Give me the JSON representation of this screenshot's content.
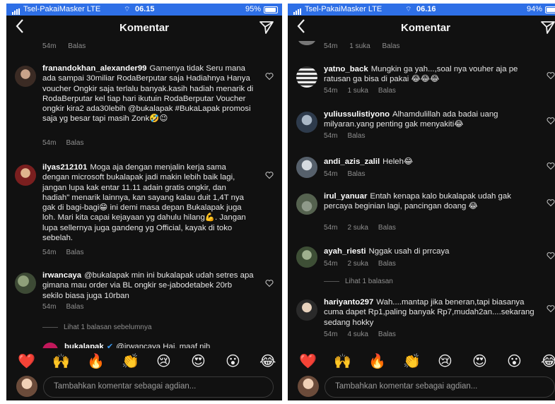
{
  "left": {
    "status": {
      "carrier": "Tsel-PakaiMasker LTE",
      "wifi": "⌔",
      "time": "06.15",
      "battery": "95%"
    },
    "header": {
      "title": "Komentar"
    },
    "top_meta": {
      "time": "54m",
      "reply": "Balas"
    },
    "comments": [
      {
        "username": "franandokhan_alexander99",
        "text": "Gamenya tidak Seru mana ada sampai 30miliar RodaBerputar saja Hadiahnya Hanya voucher Ongkir saja terlalu banyak.kasih hadiah menarik di RodaBerputar kel tiap hari ikutuin RodaBerputar Voucher ongkir kira2 ada30lebih @bukalapak #BukaLapak promosi saja yg besar tapi masih Zonk🤣😉",
        "time": "54m",
        "reply": "Balas"
      },
      {
        "username": "ilyas212101",
        "text": "Moga aja dengan menjalin kerja sama dengan microsoft bukalapak jadi makin lebih baik lagi, jangan lupa kak entar 11.11 adain gratis ongkir, dan hadiah\" menarik lainnya, kan sayang kalau duit 1,4T nya gak di bagi-bagi😁 ini demi masa depan Bukalapak juga loh. Mari kita capai kejayaan yg dahulu hilang💪. Jangan lupa sellernya juga gandeng yg Official, kayak di toko sebelah.",
        "time": "54m",
        "reply": "Balas"
      },
      {
        "username": "irwancaya",
        "text": "@bukalapak min ini bukalapak udah setres apa gimana mau order via BL ongkir se-jabodetabek 20rb sekilo biasa juga 10rban",
        "time": "54m",
        "reply": "Balas"
      }
    ],
    "view_replies": "Lihat 1 balasan sebelumnya",
    "partial": {
      "username": "bukalapak",
      "verified": "✔",
      "text": "@irwancaya Hai, maaf nih"
    },
    "compose_placeholder": "Tambahkan komentar sebagai agdian..."
  },
  "right": {
    "status": {
      "carrier": "Tsel-PakaiMasker LTE",
      "wifi": "⌔",
      "time": "06.16",
      "battery": "94%"
    },
    "header": {
      "title": "Komentar"
    },
    "top_meta": {
      "time": "54m",
      "likes": "1 suka",
      "reply": "Balas"
    },
    "comments": [
      {
        "username": "yatno_back",
        "text": "Mungkin ga yah...,soal nya vouher aja pe ratusan ga bisa di pakai 😂😂😂",
        "time": "54m",
        "likes": "1 suka",
        "reply": "Balas"
      },
      {
        "username": "yuliussulistiyono",
        "text": "Alhamdulillah ada badai uang milyaran.yang penting gak menyakiti😂",
        "time": "54m",
        "likes": "",
        "reply": "Balas"
      },
      {
        "username": "andi_azis_zalil",
        "text": "Heleh😂",
        "time": "54m",
        "likes": "",
        "reply": "Balas"
      },
      {
        "username": "irul_yanuar",
        "text": "Entah kenapa kalo bukalapak udah gak percaya beginian lagi, pancingan doang 😂",
        "time": "54m",
        "likes": "2 suka",
        "reply": "Balas"
      },
      {
        "username": "ayah_riesti",
        "text": "Nggak usah di prrcaya",
        "time": "54m",
        "likes": "2 suka",
        "reply": "Balas"
      },
      {
        "username": "hariyanto297",
        "text": "Wah....mantap jika beneran,tapi biasanya cuma dapet Rp1,paling banyak Rp7,mudah2an....sekarang sedang hokky",
        "time": "54m",
        "likes": "4 suka",
        "reply": "Balas"
      }
    ],
    "view_replies": "Lihat 1 balasan",
    "compose_placeholder": "Tambahkan komentar sebagai agdian..."
  },
  "emoji_reactions": [
    "❤️",
    "🙌",
    "🔥",
    "👏",
    "😢",
    "😍",
    "😮",
    "😂"
  ],
  "colors": {
    "status_bar": "#2e6fe6",
    "background": "#111111",
    "meta_text": "#8e8e8e",
    "username": "#ffffff"
  },
  "icons": {
    "back": "chevron-left-icon",
    "send": "send-paper-plane-icon",
    "like": "heart-outline-icon"
  }
}
